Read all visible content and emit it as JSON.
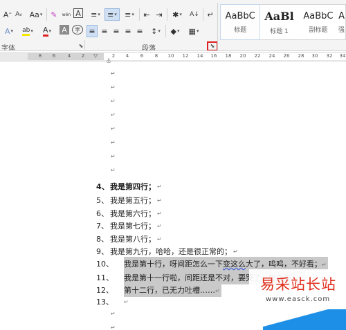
{
  "ribbon": {
    "row1": {
      "grow_font": "A",
      "shrink_font": "A",
      "change_case": "Aa",
      "phonetic": "wén",
      "char_border": "A",
      "bullets": "≡",
      "numbering": "≡",
      "multilevel": "≡",
      "decrease_indent": "⇤",
      "increase_indent": "⇥",
      "chinese_layout": "✱",
      "sort": "A↓",
      "show_marks": "↵"
    },
    "row2": {
      "text_effects": "A",
      "highlight": "ab",
      "font_color": "A",
      "char_shading": "A",
      "enclose": "字",
      "align_left": "≡",
      "center": "≡",
      "align_right": "≡",
      "justify": "≡",
      "distributed": "≡",
      "line_spacing": "↕",
      "shading": "◆",
      "borders": "▦"
    },
    "font_group_label": "字体",
    "paragraph_group_label": "段落",
    "styles": [
      {
        "sample": "AaBbC",
        "name": "标题"
      },
      {
        "sample": "AaBl",
        "name": "标题 1"
      },
      {
        "sample": "AaBbC",
        "name": "副标题"
      },
      {
        "sample": "A",
        "name": "强"
      }
    ]
  },
  "ruler": {
    "ticks": [
      "8",
      "6",
      "4",
      "2",
      "",
      "2",
      "4",
      "6",
      "8",
      "10",
      "12",
      "14",
      "16",
      "18",
      "20",
      "22",
      "24",
      "26",
      "28",
      "30",
      "32",
      "34"
    ]
  },
  "document": {
    "paragraph_mark": "↵",
    "lines": [
      {
        "num": "4、",
        "text": "我是第四行；"
      },
      {
        "num": "5、",
        "text": "我是第五行；"
      },
      {
        "num": "6、",
        "text": "我是第六行；"
      },
      {
        "num": "7、",
        "text": "我是第七行；"
      },
      {
        "num": "8、",
        "text": "我是第八行；"
      },
      {
        "num": "9、",
        "text": "我是第九行，哈哈，还是很正常的；"
      },
      {
        "num": "10、",
        "text_pre": "我是第十行，呀间距怎么一下",
        "text_sq": "变这么",
        "text_post": "大了，呜呜，不好看；"
      },
      {
        "num": "11、",
        "text": "我是第十一行啦，间距还是不对，要哭了，怎么办；"
      },
      {
        "num": "12、",
        "text": "第十二行，已无力吐槽……"
      },
      {
        "num": "13、",
        "text": ""
      }
    ]
  },
  "watermark": {
    "title": "易采站长站",
    "url": "www.easck.com"
  }
}
